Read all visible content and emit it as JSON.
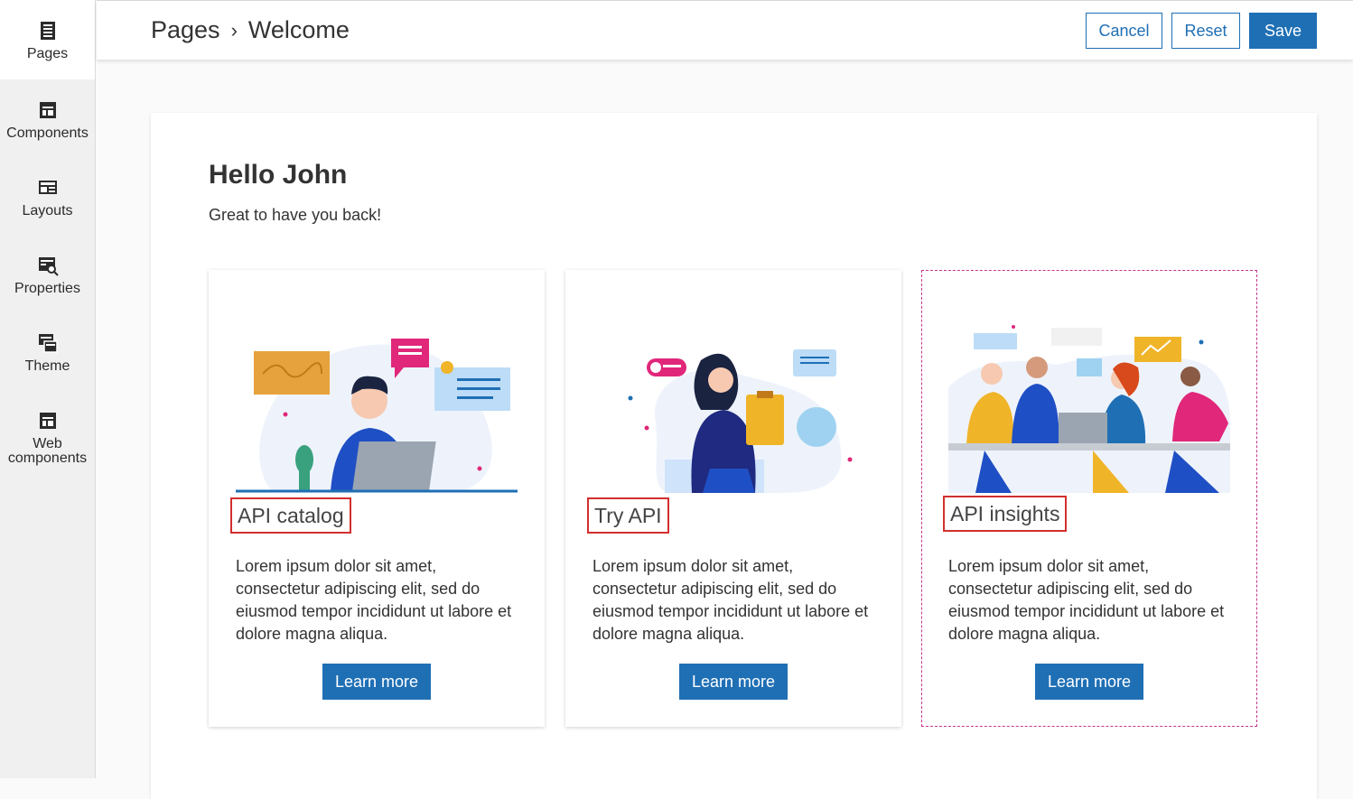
{
  "sidebar": {
    "items": [
      {
        "label": "Pages",
        "icon": "pages-icon"
      },
      {
        "label": "Components",
        "icon": "components-icon"
      },
      {
        "label": "Layouts",
        "icon": "layouts-icon"
      },
      {
        "label": "Properties",
        "icon": "properties-icon"
      },
      {
        "label": "Theme",
        "icon": "theme-icon"
      },
      {
        "label_line1": "Web",
        "label_line2": "components",
        "icon": "web-components-icon"
      }
    ]
  },
  "header": {
    "breadcrumb_root": "Pages",
    "breadcrumb_separator": "›",
    "breadcrumb_current": "Welcome",
    "cancel_label": "Cancel",
    "reset_label": "Reset",
    "save_label": "Save"
  },
  "main": {
    "greeting": "Hello John",
    "subtitle": "Great to have you back!",
    "cards": [
      {
        "title": "API catalog",
        "body": "Lorem ipsum dolor sit amet, consectetur adipiscing elit, sed do eiusmod tempor incididunt ut labore et dolore magna aliqua.",
        "button": "Learn more"
      },
      {
        "title": "Try API",
        "body": "Lorem ipsum dolor sit amet, consectetur adipiscing elit, sed do eiusmod tempor incididunt ut labore et dolore magna aliqua.",
        "button": "Learn more"
      },
      {
        "title": "API insights",
        "body": "Lorem ipsum dolor sit amet, consectetur adipiscing elit, sed do eiusmod tempor incididunt ut labore et dolore magna aliqua.",
        "button": "Learn more"
      }
    ]
  },
  "colors": {
    "accent": "#1f6fb5",
    "highlight_border": "#d32f2f",
    "selection_border": "#c2378f"
  }
}
